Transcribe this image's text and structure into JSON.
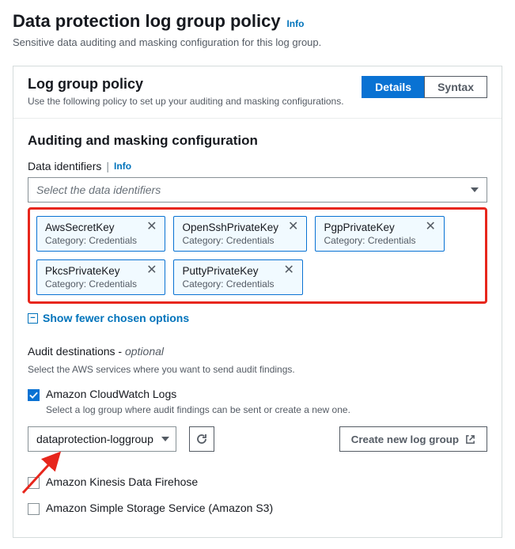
{
  "header": {
    "title": "Data protection log group policy",
    "info": "Info",
    "subtitle": "Sensitive data auditing and masking configuration for this log group."
  },
  "panel": {
    "title": "Log group policy",
    "desc": "Use the following policy to set up your auditing and masking configurations.",
    "tabs": {
      "details": "Details",
      "syntax": "Syntax"
    }
  },
  "config": {
    "heading": "Auditing and masking configuration",
    "identifiers_label": "Data identifiers",
    "identifiers_info": "Info",
    "placeholder": "Select the data identifiers",
    "tokens": [
      {
        "name": "AwsSecretKey",
        "category": "Category: Credentials"
      },
      {
        "name": "OpenSshPrivateKey",
        "category": "Category: Credentials"
      },
      {
        "name": "PgpPrivateKey",
        "category": "Category: Credentials"
      },
      {
        "name": "PkcsPrivateKey",
        "category": "Category: Credentials"
      },
      {
        "name": "PuttyPrivateKey",
        "category": "Category: Credentials"
      }
    ],
    "show_fewer": "Show fewer chosen options"
  },
  "audit": {
    "label": "Audit destinations - ",
    "optional": "optional",
    "help": "Select the AWS services where you want to send audit findings.",
    "cw": {
      "label": "Amazon CloudWatch Logs",
      "help": "Select a log group where audit findings can be sent or create a new one.",
      "selected": "dataprotection-loggroup",
      "create": "Create new log group"
    },
    "firehose": "Amazon Kinesis Data Firehose",
    "s3": "Amazon Simple Storage Service (Amazon S3)"
  }
}
